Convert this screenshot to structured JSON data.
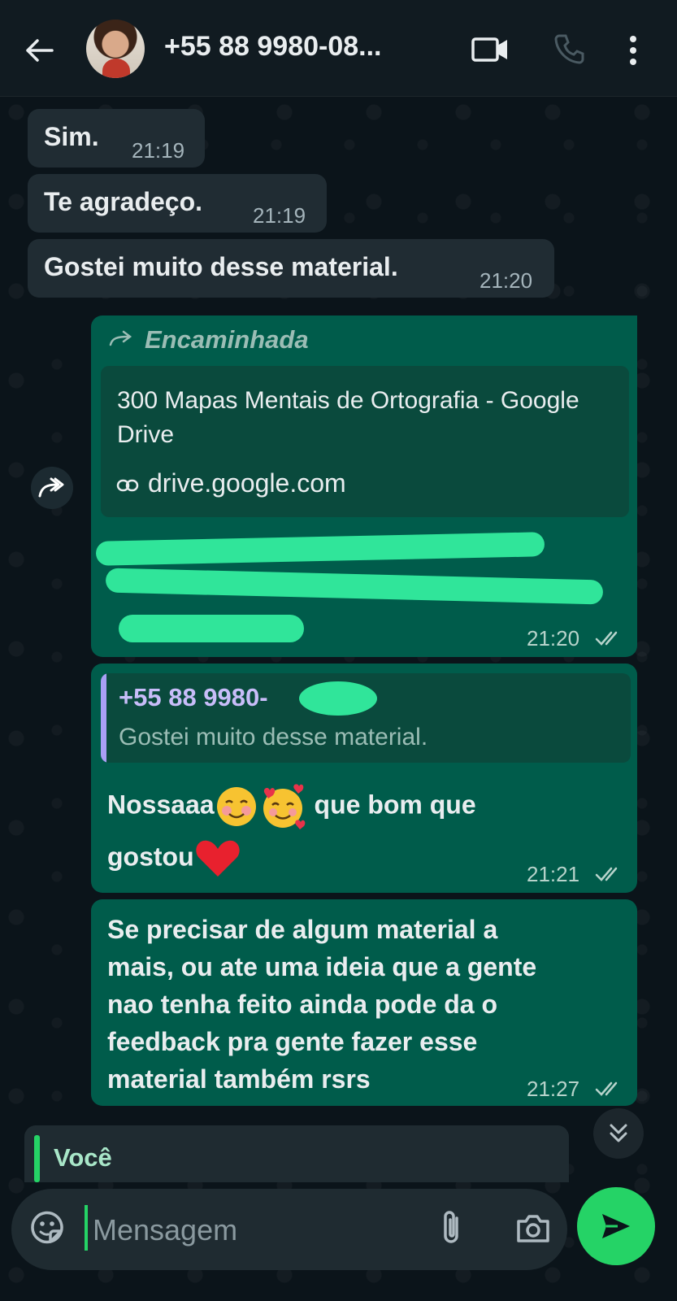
{
  "header": {
    "contact_name": "+55 88 9980-08...",
    "icons": [
      "back-arrow-icon",
      "video-call-icon",
      "voice-call-icon",
      "more-vert-icon"
    ]
  },
  "messages": [
    {
      "direction": "in",
      "text": "Sim.",
      "time": "21:19"
    },
    {
      "direction": "in",
      "text": "Te agradeço.",
      "time": "21:19"
    },
    {
      "direction": "in",
      "text": "Gostei muito desse material.",
      "time": "21:20"
    },
    {
      "direction": "out",
      "forwarded_label": "Encaminhada",
      "link_title": "300 Mapas Mentais de Ortografia - Google Drive",
      "link_domain": "drive.google.com",
      "time": "21:20"
    },
    {
      "direction": "out",
      "quoted_name": "+55 88 9980-",
      "quoted_text": "Gostei muito desse material.",
      "text_line1": "Nossaaa",
      "text_line1_after": " que bom que",
      "text_line2": "gostou",
      "time": "21:21"
    },
    {
      "direction": "out",
      "text": "Se precisar de algum material a\nmais, ou ate uma ideia que a gente\nnao tenha feito ainda pode da o\nfeedback pra gente fazer esse\nmaterial também rsrs",
      "time": "21:27"
    }
  ],
  "reply_preview": {
    "name": "Você"
  },
  "composer": {
    "placeholder": "Mensagem"
  },
  "colors": {
    "background": "#0b141a",
    "incoming_bubble": "#202c33",
    "outgoing_bubble": "#005c4b",
    "accent_green": "#25d366",
    "redaction": "#30e59a"
  }
}
